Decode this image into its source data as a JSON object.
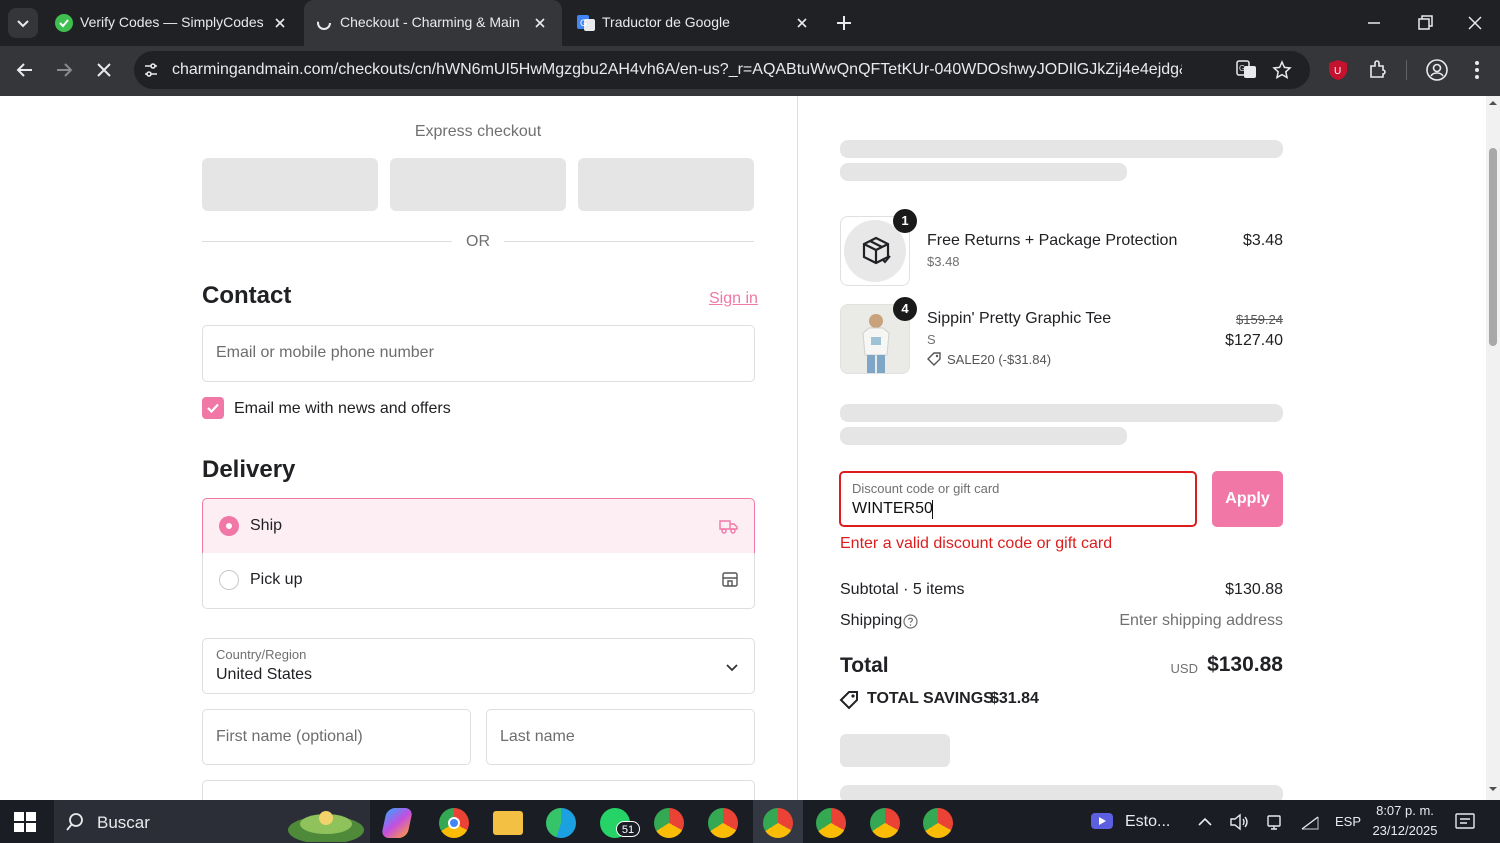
{
  "browser": {
    "tabs": [
      {
        "title": "Verify Codes — SimplyCodes",
        "favicon": "simplycodes-icon"
      },
      {
        "title": "Checkout - Charming & Main",
        "favicon": "loading-icon",
        "active": true
      },
      {
        "title": "Traductor de Google",
        "favicon": "google-translate-icon"
      }
    ],
    "url": "charmingandmain.com/checkouts/cn/hWN6mUI5HwMgzgbu2AH4vh6A/en-us?_r=AQABtuWwQnQFTetKUr-040WDOshwyJODIlGJkZij4e4ejdg&auto_redir..."
  },
  "checkout": {
    "express_title": "Express checkout",
    "or_label": "OR",
    "contact_title": "Contact",
    "sign_in": "Sign in",
    "email_placeholder": "Email or mobile phone number",
    "newsletter_label": "Email me with news and offers",
    "newsletter_checked": true,
    "delivery_title": "Delivery",
    "delivery_options": [
      {
        "label": "Ship",
        "selected": true,
        "icon": "truck-icon"
      },
      {
        "label": "Pick up",
        "selected": false,
        "icon": "store-icon"
      }
    ],
    "country_label": "Country/Region",
    "country_value": "United States",
    "first_name_placeholder": "First name (optional)",
    "last_name_placeholder": "Last name"
  },
  "summary": {
    "items": [
      {
        "qty": "1",
        "name": "Free Returns + Package Protection",
        "sub": "$3.48",
        "price": "$3.48"
      },
      {
        "qty": "4",
        "name": "Sippin' Pretty Graphic Tee",
        "variant": "S",
        "discount": "SALE20 (-$31.84)",
        "old_price": "$159.24",
        "price": "$127.40"
      }
    ],
    "discount_label": "Discount code or gift card",
    "discount_value": "WINTER50",
    "apply_label": "Apply",
    "error_text": "Enter a valid discount code or gift card",
    "subtotal_label": "Subtotal · 5 items",
    "subtotal_value": "$130.88",
    "shipping_label": "Shipping",
    "shipping_value": "Enter shipping address",
    "total_label": "Total",
    "currency": "USD",
    "total_value": "$130.88",
    "savings_label": "TOTAL SAVINGS",
    "savings_value": "$31.84"
  },
  "taskbar": {
    "search_label": "Buscar",
    "whatsapp_badge": "51",
    "media_label": "Esto...",
    "lang": "ESP",
    "time": "8:07 p. m.",
    "date": "23/12/2025"
  },
  "colors": {
    "accent": "#f077a6",
    "error": "#dd1d1d",
    "tabbar": "#202124",
    "toolbar": "#35363a"
  }
}
